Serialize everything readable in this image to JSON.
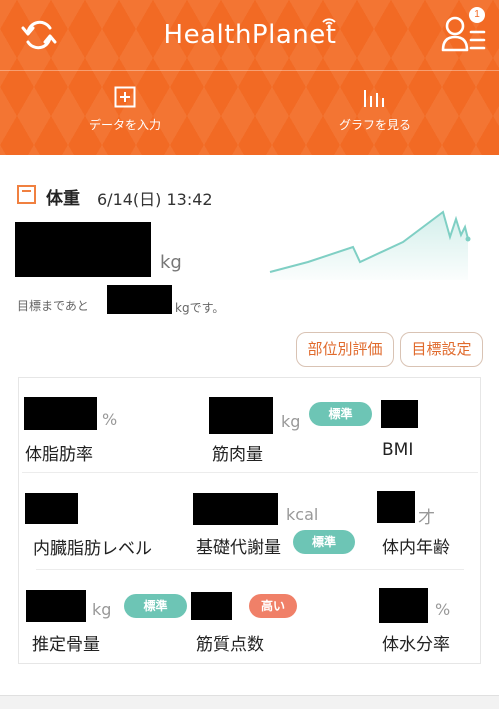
{
  "app": {
    "title": "HealthPlanet",
    "notification_count": "1"
  },
  "actions": {
    "data_entry": "データを入力",
    "graph_view": "グラフを見る"
  },
  "weight": {
    "label": "体重",
    "date": "6/14(日) 13:42",
    "unit": "kg",
    "goal_prefix": "目標まであと",
    "goal_suffix": "kgです。"
  },
  "buttons": {
    "region_eval": "部位別評価",
    "goal_setting": "目標設定"
  },
  "metrics": {
    "body_fat": {
      "label": "体脂肪率",
      "unit": "%"
    },
    "muscle": {
      "label": "筋肉量",
      "unit": "kg",
      "badge": "標準"
    },
    "bmi": {
      "label": "BMI"
    },
    "visceral": {
      "label": "内臓脂肪レベル"
    },
    "metabolism": {
      "label": "基礎代謝量",
      "unit": "kcal",
      "badge": "標準"
    },
    "body_age": {
      "label": "体内年齢",
      "unit": "才"
    },
    "bone": {
      "label": "推定骨量",
      "unit": "kg",
      "badge": "標準"
    },
    "muscle_score": {
      "label": "筋質点数",
      "badge": "高い"
    },
    "water": {
      "label": "体水分率",
      "unit": "%"
    }
  },
  "colors": {
    "header": "#f26a24",
    "accent": "#e06a2c",
    "standard": "#6dc5b5",
    "high": "#f08068",
    "trend": "#7fcfc4"
  }
}
